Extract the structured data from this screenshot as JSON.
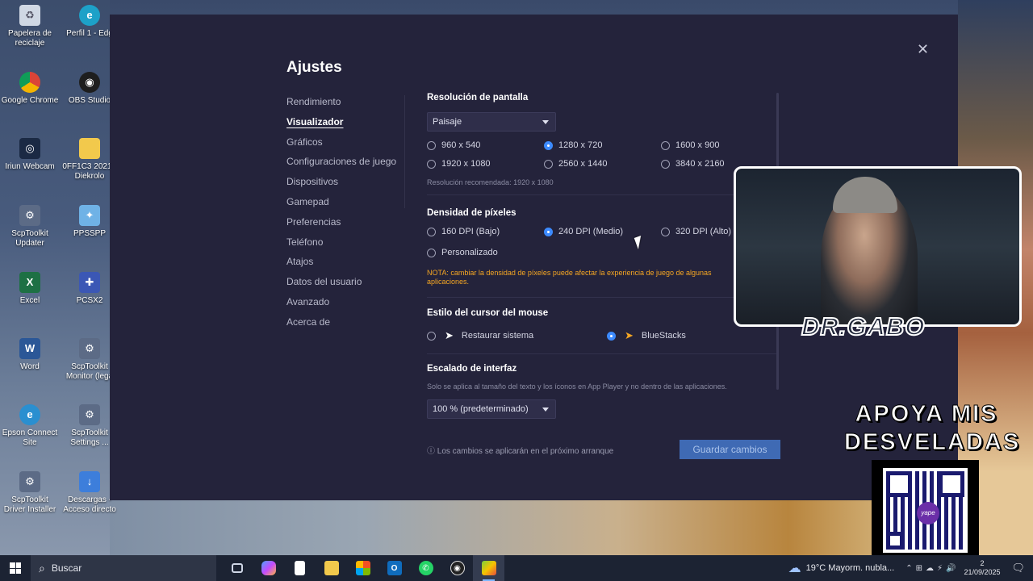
{
  "desktop": {
    "icons": [
      {
        "label": "Papelera de reciclaje",
        "icon": "recycle-bin-icon"
      },
      {
        "label": "Perfil 1 - Edg",
        "icon": "edge-icon"
      },
      {
        "label": "Google Chrome",
        "icon": "chrome-icon"
      },
      {
        "label": "OBS Studio",
        "icon": "obs-icon"
      },
      {
        "label": "Iriun Webcam",
        "icon": "webcam-icon"
      },
      {
        "label": "0FF1C3 2021 - Diekrolo",
        "icon": "folder-icon"
      },
      {
        "label": "ScpToolkit Updater",
        "icon": "scptoolkit-icon"
      },
      {
        "label": "PPSSPP",
        "icon": "ppsspp-icon"
      },
      {
        "label": "Excel",
        "icon": "excel-icon"
      },
      {
        "label": "PCSX2",
        "icon": "pcsx2-icon"
      },
      {
        "label": "Word",
        "icon": "word-icon"
      },
      {
        "label": "ScpToolkit Monitor (lega",
        "icon": "scptoolkit-icon"
      },
      {
        "label": "Epson Connect Site",
        "icon": "epson-icon"
      },
      {
        "label": "ScpToolkit Settings ...",
        "icon": "scptoolkit-icon"
      },
      {
        "label": "ScpToolkit Driver Installer",
        "icon": "scptoolkit-icon"
      },
      {
        "label": "Descargas - Acceso directo",
        "icon": "download-icon"
      }
    ]
  },
  "settings": {
    "title": "Ajustes",
    "nav": [
      {
        "label": "Rendimiento",
        "active": false
      },
      {
        "label": "Visualizador",
        "active": true
      },
      {
        "label": "Gráficos",
        "active": false
      },
      {
        "label": "Configuraciones de juego",
        "active": false
      },
      {
        "label": "Dispositivos",
        "active": false
      },
      {
        "label": "Gamepad",
        "active": false
      },
      {
        "label": "Preferencias",
        "active": false
      },
      {
        "label": "Teléfono",
        "active": false
      },
      {
        "label": "Atajos",
        "active": false
      },
      {
        "label": "Datos del usuario",
        "active": false
      },
      {
        "label": "Avanzado",
        "active": false
      },
      {
        "label": "Acerca de",
        "active": false
      }
    ],
    "resolution": {
      "title": "Resolución de pantalla",
      "orientation": "Paisaje",
      "options": [
        "960 x 540",
        "1280 x 720",
        "1600 x 900",
        "1920 x 1080",
        "2560 x 1440",
        "3840 x 2160"
      ],
      "selected": "1280 x 720",
      "recommended": "Resolución recomendada: 1920 x 1080"
    },
    "density": {
      "title": "Densidad de píxeles",
      "options": [
        "160 DPI (Bajo)",
        "240 DPI (Medio)",
        "320 DPI (Alto)",
        "Personalizado"
      ],
      "selected": "240 DPI (Medio)",
      "note": "NOTA: cambiar la densidad de píxeles puede afectar la experiencia de juego de algunas aplicaciones."
    },
    "cursor": {
      "title": "Estilo del cursor del mouse",
      "options": [
        "Restaurar sistema",
        "BlueStacks"
      ],
      "selected": "BlueStacks"
    },
    "scaling": {
      "title": "Escalado de interfaz",
      "hint": "Solo se aplica al tamaño del texto y los íconos en App Player y no dentro de las aplicaciones.",
      "value": "100 % (predeterminado)"
    },
    "footer_note": "ⓘ Los cambios se aplicarán en el próximo arranque",
    "save_label": "Guardar cambios"
  },
  "overlay": {
    "streamer_name": "DR.GABO",
    "support_text": "APOYA MIS DESVELADAS",
    "qr_logo": "yape"
  },
  "taskbar": {
    "search_label": "Buscar",
    "weather": "19°C  Mayorm. nubla...",
    "time": "2",
    "date": "21/09/2025",
    "apps": [
      "task-view-icon",
      "copilot-icon",
      "file-icon",
      "explorer-icon",
      "store-icon",
      "outlook-icon",
      "whatsapp-icon",
      "obs-icon",
      "bluestacks-icon"
    ]
  },
  "colors": {
    "window_bg": "#24233b",
    "accent": "#3d8bff",
    "note": "#f5a623",
    "save_button": "#3f6ab4"
  }
}
